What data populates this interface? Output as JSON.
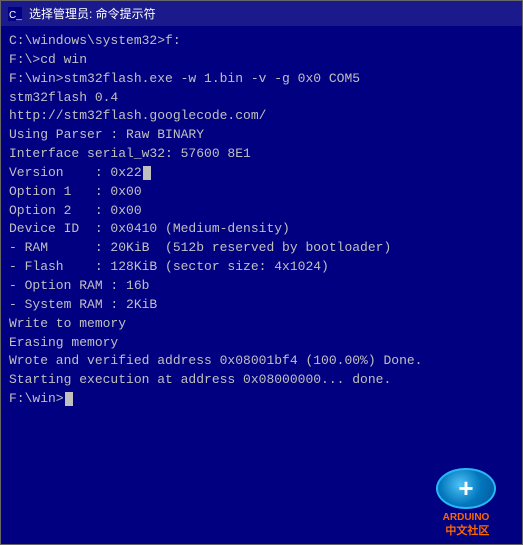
{
  "window": {
    "title": "选择管理员: 命令提示符",
    "title_prefix": "cmd"
  },
  "terminal": {
    "lines": [
      "C:\\windows\\system32>f:",
      "",
      "F:\\>cd win",
      "",
      "F:\\win>stm32flash.exe -w 1.bin -v -g 0x0 COM5",
      "stm32flash 0.4",
      "",
      "http://stm32flash.googlecode.com/",
      "",
      "Using Parser : Raw BINARY",
      "Interface serial_w32: 57600 8E1",
      "Version    : 0x22",
      "Option 1   : 0x00",
      "Option 2   : 0x00",
      "Device ID  : 0x0410 (Medium-density)",
      "- RAM      : 20KiB  (512b reserved by bootloader)",
      "- Flash    : 128KiB (sector size: 4x1024)",
      "- Option RAM : 16b",
      "- System RAM : 2KiB",
      "Write to memory",
      "Erasing memory",
      "Wrote and verified address 0x08001bf4 (100.00%) Done.",
      "",
      "Starting execution at address 0x08000000... done.",
      "",
      "F:\\win>"
    ]
  },
  "logo": {
    "label": "ARDUINO",
    "sublabel": "中文社区"
  }
}
